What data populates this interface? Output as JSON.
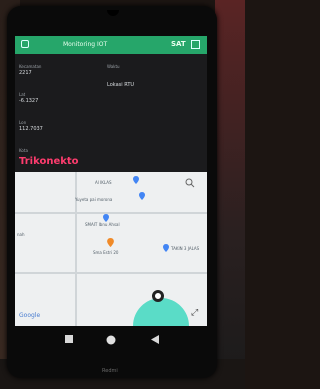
{
  "app": {
    "title": "Monitoring IOT",
    "count_value": "SAT"
  },
  "fields": [
    {
      "label": "Kecamatan",
      "value": "2217"
    },
    {
      "label": "Lat",
      "value": "-6.1327"
    },
    {
      "label": "Lon",
      "value": "112.7037"
    }
  ],
  "status": {
    "label": "Waktu",
    "value": "Lokasi RTU"
  },
  "kota": {
    "label": "Kota",
    "value": "Trikonekto"
  },
  "map": {
    "places": [
      {
        "name": "Al IKLAS"
      },
      {
        "name": "Yuyeta pai morona"
      },
      {
        "name": "SMAIT Ibnu Ahsal"
      },
      {
        "name": "Sma Estri 20"
      },
      {
        "name": "TAKIN 3 JALAS"
      },
      {
        "name": "nah"
      }
    ],
    "attribution": "Google"
  },
  "brand": "Redmi",
  "colors": {
    "appbar": "#26a66a",
    "kota_text": "#ff3c6e",
    "accuracy_circle": "#3fd8bf",
    "pin_blue": "#4285f4",
    "pin_orange": "#f08a28"
  }
}
